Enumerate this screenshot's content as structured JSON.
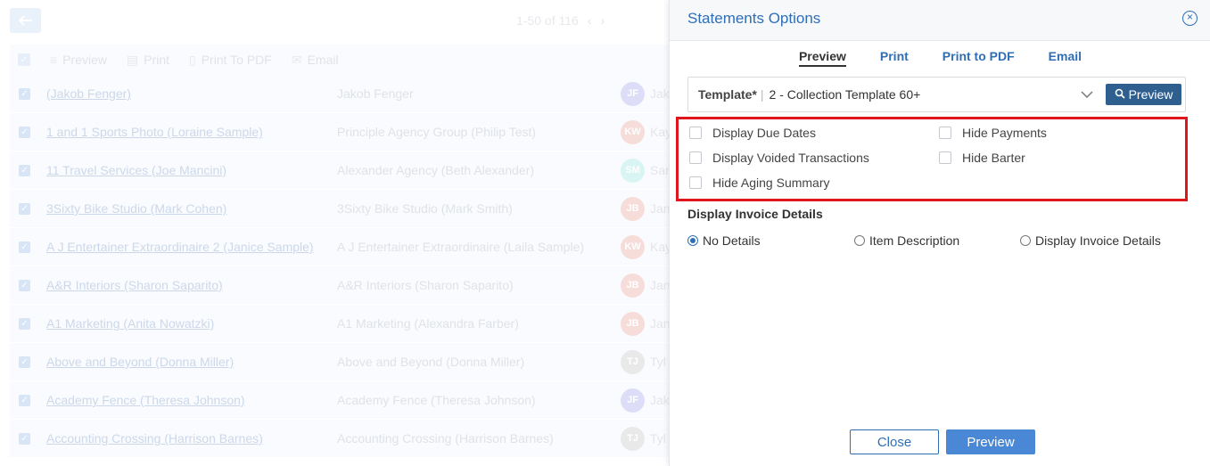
{
  "background": {
    "pager_text": "1-50 of 116",
    "toolbar": {
      "preview": "Preview",
      "print": "Print",
      "print_to_pdf": "Print To PDF",
      "email": "Email"
    },
    "rows": [
      {
        "name": "(Jakob Fenger)",
        "agency": "Jakob Fenger",
        "initials": "JF",
        "avatar_color": "#b6b4ef",
        "owner": "Jak"
      },
      {
        "name": "1 and 1 Sports Photo (Loraine Sample)",
        "agency": "Principle Agency Group (Philip Test)",
        "initials": "KW",
        "avatar_color": "#eab3ae",
        "owner": "Kay"
      },
      {
        "name": "11 Travel Services (Joe Mancini)",
        "agency": "Alexander Agency (Beth Alexander)",
        "initials": "SM",
        "avatar_color": "#a9e9e4",
        "owner": "Sar"
      },
      {
        "name": "3Sixty Bike Studio (Mark Cohen)",
        "agency": "3Sixty Bike Studio (Mark Smith)",
        "initials": "JB",
        "avatar_color": "#eab3ae",
        "owner": "Jan"
      },
      {
        "name": "A J Entertainer Extraordinaire 2 (Janice Sample)",
        "agency": "A J Entertainer Extraordinaire (Laila Sample)",
        "initials": "KW",
        "avatar_color": "#eab3ae",
        "owner": "Kay"
      },
      {
        "name": "A&R Interiors (Sharon Saparito)",
        "agency": "A&R Interiors (Sharon Saparito)",
        "initials": "JB",
        "avatar_color": "#eab3ae",
        "owner": "Jan"
      },
      {
        "name": "A1 Marketing (Anita Nowatzki)",
        "agency": "A1 Marketing (Alexandra Farber)",
        "initials": "JB",
        "avatar_color": "#eab3ae",
        "owner": "Jan"
      },
      {
        "name": "Above and Beyond (Donna Miller)",
        "agency": "Above and Beyond (Donna Miller)",
        "initials": "TJ",
        "avatar_color": "#cfcfcf",
        "owner": "Tyl"
      },
      {
        "name": "Academy Fence (Theresa Johnson)",
        "agency": "Academy Fence (Theresa Johnson)",
        "initials": "JF",
        "avatar_color": "#b6b4ef",
        "owner": "Jak"
      },
      {
        "name": "Accounting Crossing (Harrison Barnes)",
        "agency": "Accounting Crossing (Harrison Barnes)",
        "initials": "TJ",
        "avatar_color": "#cfcfcf",
        "owner": "Tyl"
      }
    ]
  },
  "panel": {
    "title": "Statements Options",
    "tabs": [
      "Preview",
      "Print",
      "Print to PDF",
      "Email"
    ],
    "template": {
      "label": "Template*",
      "value": "2 - Collection Template 60+",
      "preview_button": "Preview"
    },
    "options": {
      "display_due_dates": "Display Due Dates",
      "display_voided_transactions": "Display Voided Transactions",
      "hide_aging_summary": "Hide Aging Summary",
      "hide_payments": "Hide Payments",
      "hide_barter": "Hide Barter"
    },
    "invoice_details": {
      "title": "Display Invoice Details",
      "options": [
        "No Details",
        "Item Description",
        "Display Invoice Details"
      ],
      "selected": "No Details"
    },
    "footer": {
      "close": "Close",
      "preview": "Preview"
    },
    "colors": {
      "accent": "#2f6eb5",
      "highlight_border": "#e0161f",
      "primary_button": "#4a87d4"
    }
  }
}
